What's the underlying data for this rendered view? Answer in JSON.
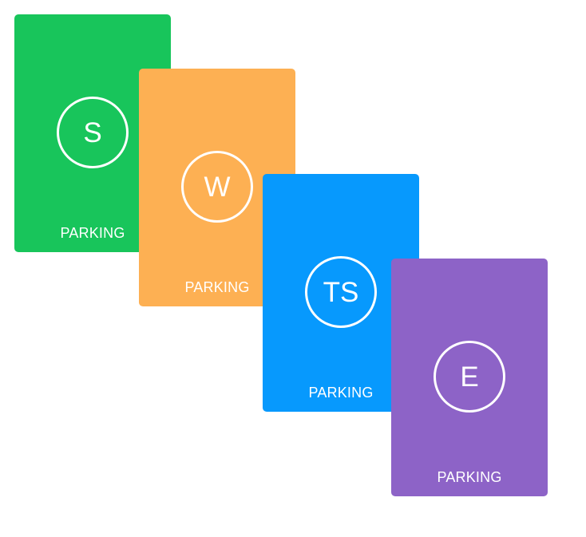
{
  "cards": [
    {
      "initials": "S",
      "label": "PARKING",
      "color": "#18c55b"
    },
    {
      "initials": "W",
      "label": "PARKING",
      "color": "#fdb053"
    },
    {
      "initials": "TS",
      "label": "PARKING",
      "color": "#0799fd"
    },
    {
      "initials": "E",
      "label": "PARKING",
      "color": "#8d63c7"
    }
  ]
}
